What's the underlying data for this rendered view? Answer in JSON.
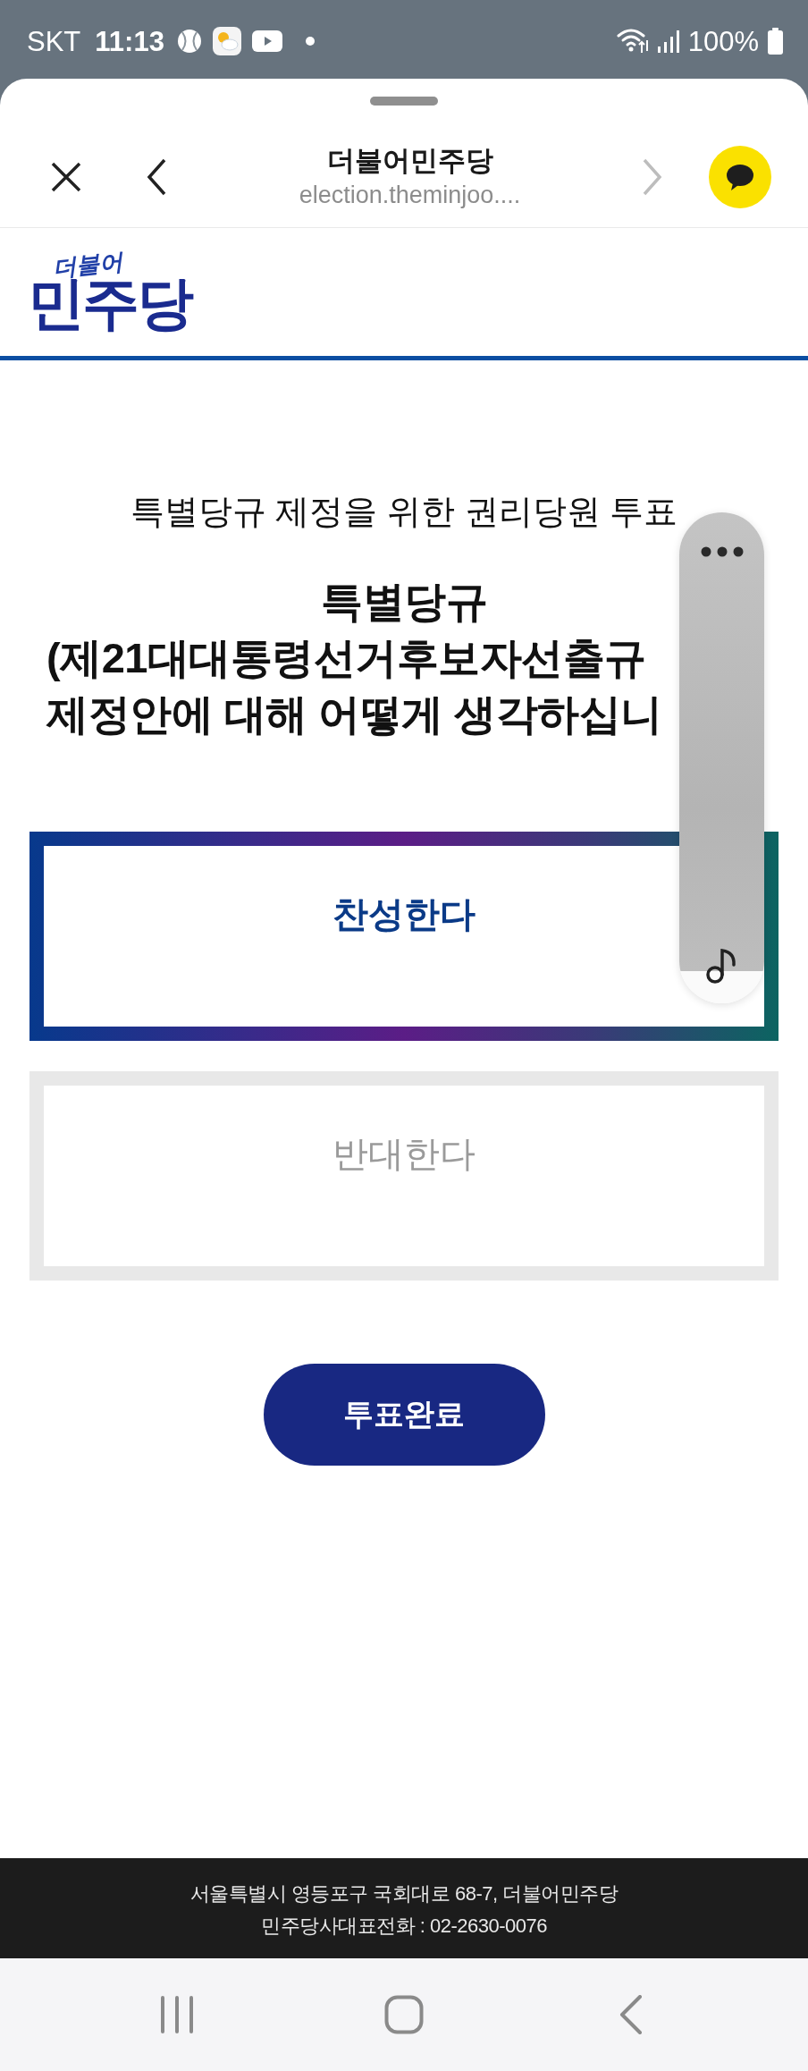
{
  "status_bar": {
    "carrier": "SKT",
    "time": "11:13",
    "battery": "100%"
  },
  "browser_bar": {
    "title": "더불어민주당",
    "url": "election.theminjoo....",
    "forward_button": {
      "disabled": true
    }
  },
  "site_header": {
    "logo_script": "더불어",
    "logo_wordmark": "민주당"
  },
  "vote": {
    "subtitle": "특별당규 제정을 위한 권리당원 투표",
    "question_lines": [
      "특별당규",
      "(제21대대통령선거후보자선출규",
      "제정안에 대해 어떻게 생각하십니"
    ],
    "options": [
      {
        "label": "찬성한다",
        "selected": true
      },
      {
        "label": "반대한다",
        "selected": false
      }
    ],
    "submit": "투표완료"
  },
  "footer": {
    "lines": [
      "서울특별시 영등포구 국회대로 68-7, 더불어민주당",
      "민주당사대표전화 : 02-2630-0076"
    ]
  }
}
